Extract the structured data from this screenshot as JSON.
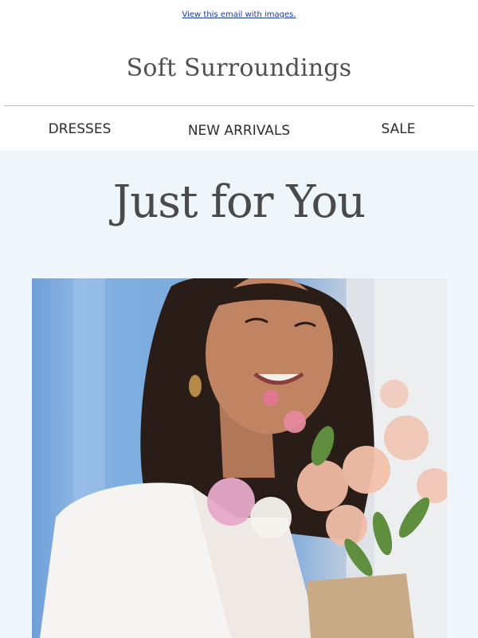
{
  "email": {
    "view_link": "View this email with images."
  },
  "brand": {
    "logo_text": "Soft Surroundings"
  },
  "nav": {
    "items": [
      "DRESSES",
      "NEW ARRIVALS",
      "SALE"
    ]
  },
  "hero": {
    "title": "Just for You",
    "image_alt": "Smiling woman in a white blouse holding a bouquet of pink and peach flowers"
  },
  "colors": {
    "hero_background": "#eef6fb",
    "link": "#1a3aa8",
    "title_text": "#4a4a4a"
  }
}
